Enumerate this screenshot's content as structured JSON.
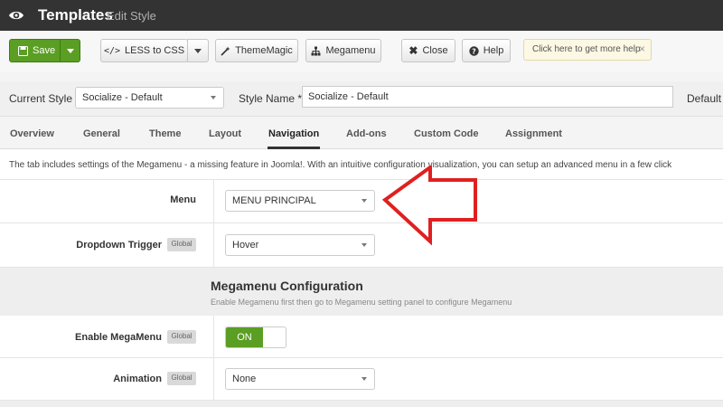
{
  "header": {
    "title": "Templates",
    "subtitle": "Edit Style",
    "icon": "eye-icon"
  },
  "toolbar": {
    "save_label": "Save",
    "less_label": "LESS to CSS",
    "thememagic_label": "ThemeMagic",
    "megamenu_label": "Megamenu",
    "close_label": "Close",
    "help_label": "Help",
    "hint_text": "Click here to get more help",
    "hint_close": "×"
  },
  "style": {
    "current_style_label": "Current Style",
    "current_style_value": "Socialize - Default",
    "style_name_label": "Style Name *",
    "style_name_value": "Socialize - Default",
    "default_label": "Default"
  },
  "tabs": [
    {
      "label": "Overview"
    },
    {
      "label": "General"
    },
    {
      "label": "Theme"
    },
    {
      "label": "Layout"
    },
    {
      "label": "Navigation"
    },
    {
      "label": "Add-ons"
    },
    {
      "label": "Custom Code"
    },
    {
      "label": "Assignment"
    }
  ],
  "active_tab": "Navigation",
  "description": "The tab includes settings of the Megamenu - a missing feature in Joomla!. With an intuitive configuration visualization, you can setup an advanced menu in a few click",
  "fields": {
    "menu": {
      "label": "Menu",
      "value": "MENU PRINCIPAL"
    },
    "dropdown": {
      "label": "Dropdown Trigger",
      "badge": "Global",
      "value": "Hover"
    },
    "enable_megamenu": {
      "label": "Enable MegaMenu",
      "badge": "Global",
      "value": "ON"
    },
    "animation": {
      "label": "Animation",
      "badge": "Global",
      "value": "None"
    }
  },
  "megamenu_section": {
    "title": "Megamenu Configuration",
    "description": "Enable Megamenu first then go to Megamenu setting panel to configure Megamenu"
  },
  "colors": {
    "accent_green": "#5a9e23",
    "header_dark": "#333333",
    "arrow_red": "#e02020"
  }
}
